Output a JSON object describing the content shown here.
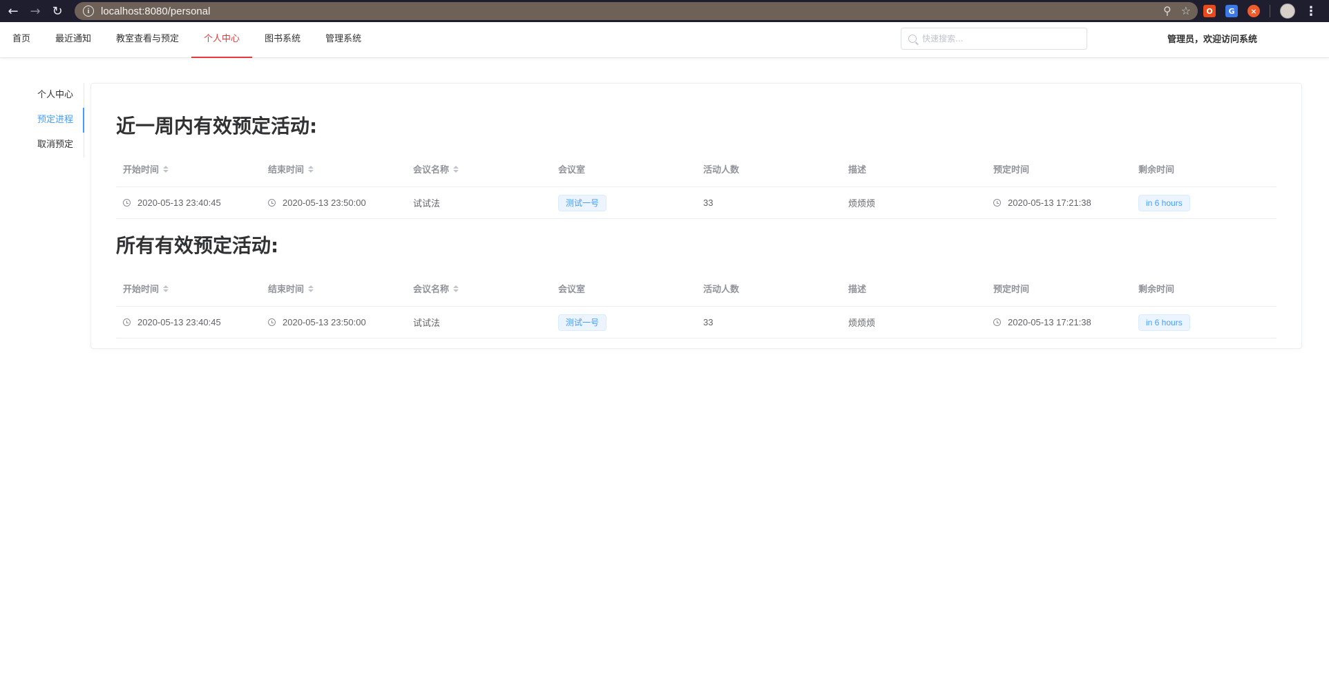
{
  "browser": {
    "url": "localhost:8080/personal"
  },
  "nav": {
    "items": [
      {
        "label": "首页"
      },
      {
        "label": "最近通知"
      },
      {
        "label": "教室查看与预定"
      },
      {
        "label": "个人中心",
        "active": true
      },
      {
        "label": "图书系统"
      },
      {
        "label": "管理系统"
      }
    ],
    "search_placeholder": "快速搜索...",
    "welcome": "管理员，欢迎访问系统",
    "active_color": "#e4393c"
  },
  "side": {
    "items": [
      {
        "label": "个人中心"
      },
      {
        "label": "预定进程",
        "active": true
      },
      {
        "label": "取消预定"
      }
    ],
    "active_color": "#409eff"
  },
  "week_section": {
    "title": "近一周内有效预定活动:",
    "columns": [
      "开始时间",
      "结束时间",
      "会议名称",
      "会议室",
      "活动人数",
      "描述",
      "预定时间",
      "剩余时间"
    ],
    "rows": [
      {
        "start": "2020-05-13 23:40:45",
        "end": "2020-05-13 23:50:00",
        "name": "试试法",
        "room": "测试一号",
        "people": "33",
        "desc": "烦烦烦",
        "booked": "2020-05-13 17:21:38",
        "remaining": "in 6 hours"
      }
    ]
  },
  "all_section": {
    "title": "所有有效预定活动:",
    "columns": [
      "开始时间",
      "结束时间",
      "会议名称",
      "会议室",
      "活动人数",
      "描述",
      "预定时间",
      "剩余时间"
    ],
    "rows": [
      {
        "start": "2020-05-13 23:40:45",
        "end": "2020-05-13 23:50:00",
        "name": "试试法",
        "room": "测试一号",
        "people": "33",
        "desc": "烦烦烦",
        "booked": "2020-05-13 17:21:38",
        "remaining": "in 6 hours"
      }
    ]
  }
}
